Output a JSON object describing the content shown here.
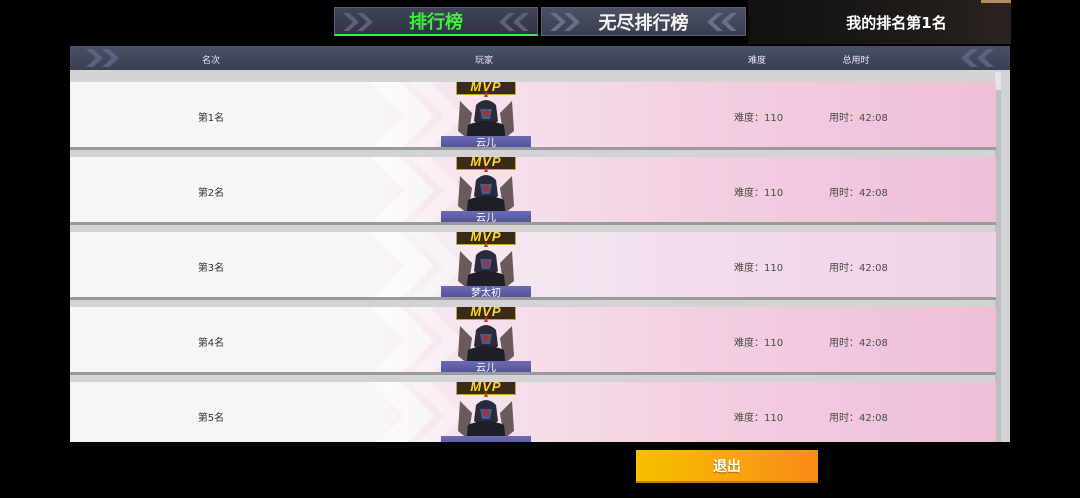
{
  "tabs": {
    "leaderboard": "排行榜",
    "endless_leaderboard": "无尽排行榜"
  },
  "my_rank": "我的排名第1名",
  "table": {
    "headers": {
      "rank": "名次",
      "player": "玩家",
      "difficulty": "难度",
      "total_time": "总用时"
    },
    "rows": [
      {
        "rank": "第1名",
        "player": "云儿",
        "badge": "MVP",
        "difficulty": "难度：110",
        "time": "用时：42:08"
      },
      {
        "rank": "第2名",
        "player": "云儿",
        "badge": "MVP",
        "difficulty": "难度：110",
        "time": "用时：42:08"
      },
      {
        "rank": "第3名",
        "player": "梦太初",
        "badge": "MVP",
        "difficulty": "难度：110",
        "time": "用时：42:08"
      },
      {
        "rank": "第4名",
        "player": "云儿",
        "badge": "MVP",
        "difficulty": "难度：110",
        "time": "用时：42:08"
      },
      {
        "rank": "第5名",
        "player": "",
        "badge": "MVP",
        "difficulty": "难度：110",
        "time": "用时：42:08"
      }
    ]
  },
  "exit_button": "退出",
  "colors": {
    "active_tab_text": "#3df03a",
    "exit_button": "#f8a70a",
    "player_label_bg": "#5b5aa0"
  }
}
